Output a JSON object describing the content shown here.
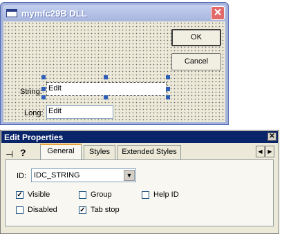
{
  "dialog": {
    "title": "mymfc29B DLL",
    "ok_label": "OK",
    "cancel_label": "Cancel",
    "string_label": "String:",
    "string_value": "Edit",
    "long_label": "Long:",
    "long_value": "Edit"
  },
  "properties": {
    "title": "Edit Properties",
    "pin_glyph": "⊣",
    "help_glyph": "?",
    "tabs": [
      {
        "label": "General",
        "active": true
      },
      {
        "label": "Styles",
        "active": false
      },
      {
        "label": "Extended Styles",
        "active": false
      }
    ],
    "id_label": "ID:",
    "id_value": "IDC_STRING",
    "checkboxes": {
      "visible": {
        "label": "Visible",
        "checked": true
      },
      "group": {
        "label": "Group",
        "checked": false
      },
      "help_id": {
        "label": "Help ID",
        "checked": false
      },
      "disabled": {
        "label": "Disabled",
        "checked": false
      },
      "tab_stop": {
        "label": "Tab stop",
        "checked": true
      }
    }
  },
  "icons": {
    "close": "✕",
    "check": "✓",
    "dropdown": "▼",
    "scroll_left": "◀",
    "scroll_right": "▶"
  }
}
